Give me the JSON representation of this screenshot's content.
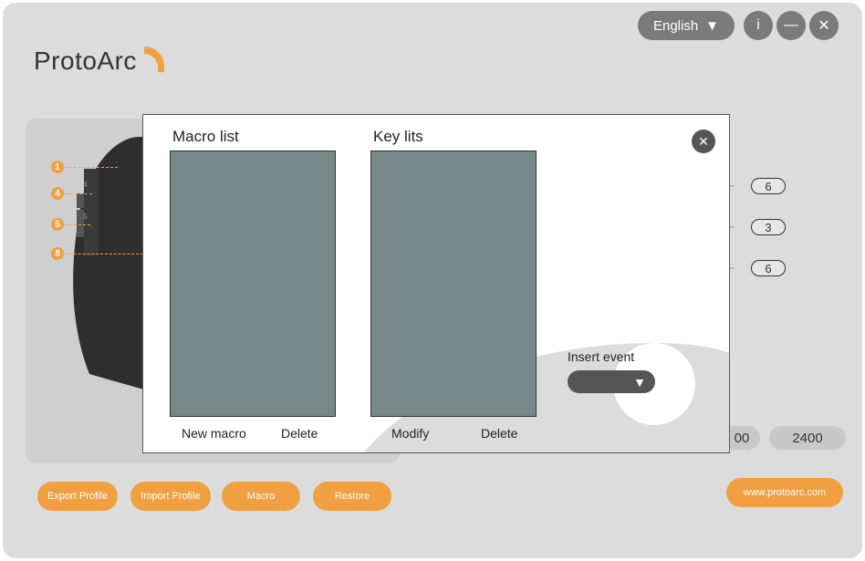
{
  "app": {
    "logo_text": "ProtoArc",
    "language": "English",
    "window_controls": {
      "info": "i",
      "minimize": "—",
      "close": "✕"
    },
    "accent_color": "#f0a040"
  },
  "mouse_buttons": [
    "1",
    "4",
    "5",
    "8"
  ],
  "mouse_side_labels": [
    "4",
    "5"
  ],
  "settings_values": [
    "6",
    "3",
    "6"
  ],
  "dpi_values": [
    "00",
    "2400"
  ],
  "bottom_buttons": {
    "export": "Export Profile",
    "import": "Import Profile",
    "macro": "Macro",
    "restore": "Restore",
    "website": "www.protoarc.com"
  },
  "dialog": {
    "macro_list_title": "Macro list",
    "key_list_title": "Key lits",
    "new_macro": "New macro",
    "delete_macro": "Delete",
    "modify": "Modify",
    "delete_key": "Delete",
    "insert_event_label": "Insert event",
    "insert_event_value": "",
    "close": "✕"
  }
}
